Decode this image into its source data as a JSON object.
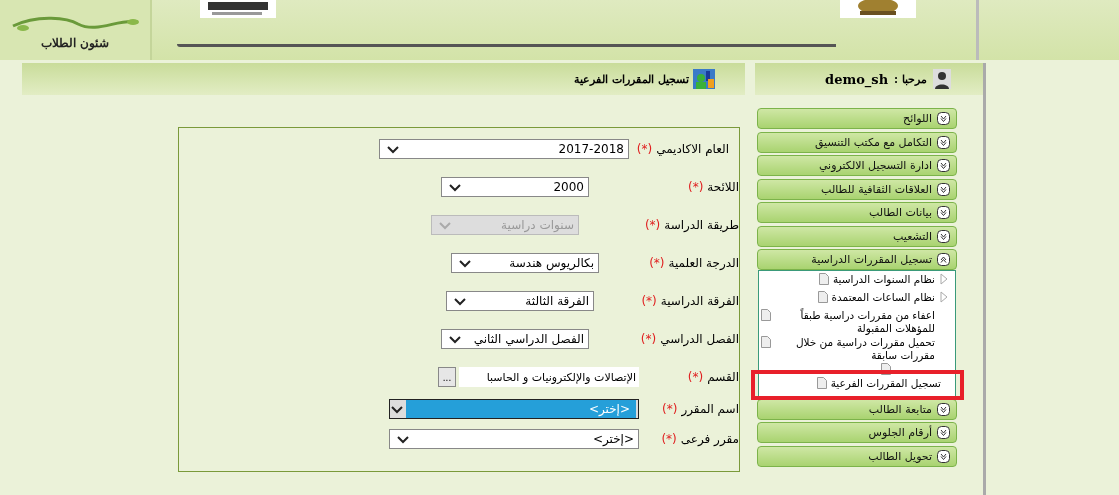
{
  "header": {
    "section_label": "شئون الطلاب"
  },
  "page": {
    "title": "تسجيل المقررات الفرعية"
  },
  "form": {
    "fields": [
      {
        "kind": "select",
        "label": "العام الاكاديمي",
        "required": "(*)",
        "value": "2017-2018",
        "disabled": false,
        "highlighted": false
      },
      {
        "kind": "select",
        "label": "اللائحة",
        "required": "(*)",
        "value": "2000",
        "disabled": false,
        "highlighted": false
      },
      {
        "kind": "select",
        "label": "طريقة الدراسة",
        "required": "(*)",
        "value": "سنوات دراسية",
        "disabled": true,
        "highlighted": false
      },
      {
        "kind": "select",
        "label": "الدرجة العلمية",
        "required": "(*)",
        "value": "بكالريوس هندسة",
        "disabled": false,
        "highlighted": false
      },
      {
        "kind": "select",
        "label": "الفرقة الدراسية",
        "required": "(*)",
        "value": "الفرقة الثالثة",
        "disabled": false,
        "highlighted": false
      },
      {
        "kind": "select",
        "label": "الفصل الدراسي",
        "required": "(*)",
        "value": "الفصل الدراسي الثاني",
        "disabled": false,
        "highlighted": false
      },
      {
        "kind": "lookup",
        "label": "القسم",
        "required": "(*)",
        "value": "الإتصالات والإلكترونيات و الحاسبا",
        "button": "..."
      },
      {
        "kind": "select",
        "label": "اسم المقرر",
        "required": "(*)",
        "value": "<إختر>",
        "disabled": false,
        "highlighted": true
      },
      {
        "kind": "select",
        "label": "مقرر فرعى",
        "required": "(*)",
        "value": "<إختر>",
        "disabled": false,
        "highlighted": false
      }
    ]
  },
  "sidebar": {
    "greeting": "مرحبا :",
    "user": "demo_sh",
    "menu": [
      {
        "label": "اللوائح",
        "expanded": false
      },
      {
        "label": "التكامل مع مكتب التنسيق",
        "expanded": false
      },
      {
        "label": "ادارة التسجيل الالكتروني",
        "expanded": false
      },
      {
        "label": "العلاقات الثقافية للطالب",
        "expanded": false
      },
      {
        "label": "بيانات الطالب",
        "expanded": false
      },
      {
        "label": "التشعيب",
        "expanded": false
      },
      {
        "label": "تسجيل المقررات الدراسية",
        "expanded": true,
        "children": [
          {
            "kind": "submenu",
            "label": "نظام السنوات الدراسية"
          },
          {
            "kind": "submenu",
            "label": "نظام الساعات المعتمدة"
          },
          {
            "kind": "link",
            "label": "اعفاء من مقررات دراسية طبقاً للمؤهلات المقبولة"
          },
          {
            "kind": "link",
            "label": "تحميل مقررات دراسية من خلال مقررات سابقة"
          },
          {
            "kind": "obscured"
          },
          {
            "kind": "link",
            "label": "تسجيل المقررات الفرعية",
            "highlighted": true
          }
        ]
      },
      {
        "label": "متابعة الطالب",
        "expanded": false
      },
      {
        "label": "أرقام الجلوس",
        "expanded": false
      },
      {
        "label": "تحويل الطالب",
        "expanded": false
      }
    ]
  }
}
